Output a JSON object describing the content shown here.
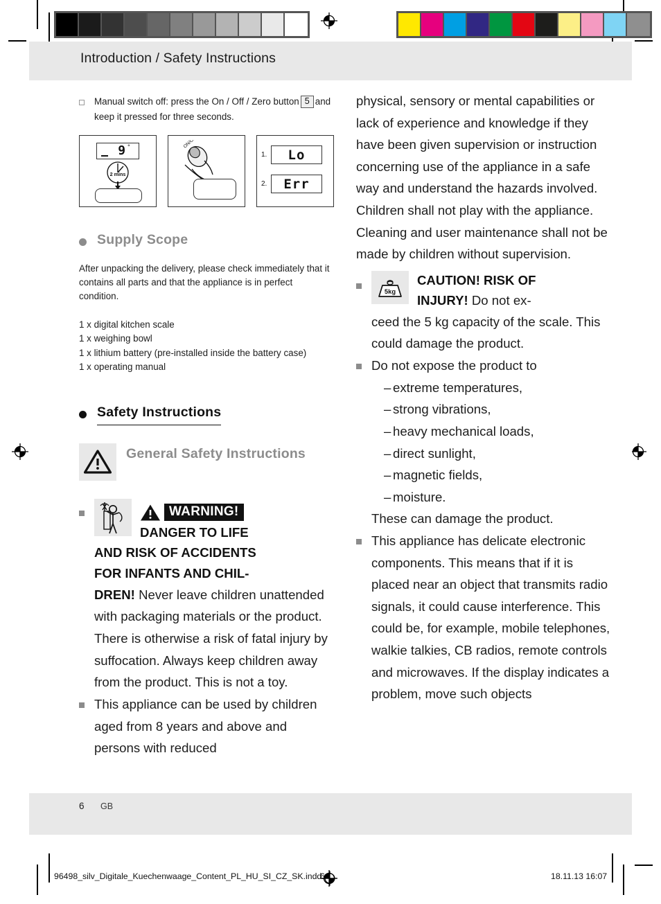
{
  "print_marks": {
    "grayscale_swatches": [
      "#000000",
      "#1b1b1b",
      "#333333",
      "#4d4d4d",
      "#666666",
      "#808080",
      "#999999",
      "#b3b3b3",
      "#cccccc",
      "#e9e9e9",
      "#ffffff"
    ],
    "color_swatches": [
      "#ffe800",
      "#e6007e",
      "#009fe3",
      "#312783",
      "#009640",
      "#e30613",
      "#1d1d1b",
      "#fcef87",
      "#f49ac1",
      "#7fd4f4",
      "#8f8f8f"
    ],
    "registration_icon": "registration-target-icon"
  },
  "header": {
    "title": "Introduction / Safety Instructions"
  },
  "footer": {
    "page_number": "6",
    "language_code": "GB",
    "imprint_filename": "96498_silv_Digitale_Kuechenwaage_Content_PL_HU_SI_CZ_SK.indd",
    "imprint_page": "6",
    "timestamp": "18.11.13   16:07"
  },
  "left_column": {
    "manual_switch_off": {
      "bullet_icon": "hollow-square-bullet",
      "text_before_key": "Manual switch off: press the On / Off / Zero button",
      "key_label": "5",
      "text_after_key": "and keep it pressed for three seconds."
    },
    "figures": [
      {
        "name": "auto-switch-off-figure",
        "display_value": "9",
        "display_unit": "°",
        "timer_label": "2 mins"
      },
      {
        "name": "press-on-off-button-figure",
        "button_label": "ON/OFF"
      },
      {
        "name": "error-codes-figure",
        "items": [
          {
            "index": "1.",
            "code": "Lo"
          },
          {
            "index": "2.",
            "code": "Err"
          }
        ]
      }
    ],
    "supply_scope": {
      "heading": "Supply Scope",
      "intro": "After unpacking the delivery, please check immediately that it contains all parts and that the appliance is in perfect condition.",
      "items": [
        "1 x digital kitchen scale",
        "1 x weighing bowl",
        "1 x lithium battery (pre-installed inside the battery case)",
        "1 x operating manual"
      ]
    },
    "safety_instructions": {
      "heading": "Safety Instructions",
      "subheading_icon": "warning-triangle-icon",
      "subheading": "General Safety Instructions",
      "warning_item": {
        "bullet_icon": "square-bullet",
        "pictogram": "child-with-plastic-bag-icon",
        "warning_triangle_icon": "warning-triangle-icon",
        "warning_label": "WARNING!",
        "bold_lead": "DANGER TO LIFE AND RISK OF ACCIDENTS FOR INFANTS AND CHIL-DREN!",
        "bold_lead_line1": "DANGER TO LIFE",
        "bold_lead_line2": "AND RISK OF ACCIDENTS",
        "bold_lead_line3": "FOR INFANTS AND CHIL-",
        "bold_lead_line4": "DREN!",
        "body": "Never leave children unattended with packaging materials or the product. There is otherwise a risk of fatal injury by suffocation. Always keep children away from the product. This is not a toy."
      },
      "children_item": {
        "bullet_icon": "square-bullet",
        "body": "This appliance can be used by children aged from 8 years and above and persons with reduced"
      }
    }
  },
  "right_column": {
    "continuation_paragraph": "physical, sensory or mental capabilities or lack of experience and knowledge if they have been given supervision or instruction concerning use of the appliance in a safe way and understand the hazards involved. Children shall not play with the appliance. Cleaning and user maintenance shall not be made by children without supervision.",
    "caution_item": {
      "bullet_icon": "square-bullet",
      "pictogram": "5kg-weight-icon",
      "pictogram_label": "5 kg",
      "bold_lead_line1": "CAUTION! RISK OF",
      "bold_lead_line2": "INJURY!",
      "body": "Do not exceed the 5 kg capacity of the scale. This could damage the product."
    },
    "expose_item": {
      "bullet_icon": "square-bullet",
      "lead": "Do not expose the product to",
      "dash_items": [
        "extreme temperatures,",
        "strong vibrations,",
        "heavy mechanical loads,",
        "direct sunlight,",
        "magnetic fields,",
        "moisture."
      ],
      "closing": "These can damage the product."
    },
    "electronics_item": {
      "bullet_icon": "square-bullet",
      "body": "This appliance has delicate electronic components. This means that if it is placed near an object that transmits radio signals, it could cause interference. This could be, for example, mobile telephones, walkie talkies, CB radios, remote controls and microwaves. If the display indicates a problem, move such objects"
    }
  }
}
